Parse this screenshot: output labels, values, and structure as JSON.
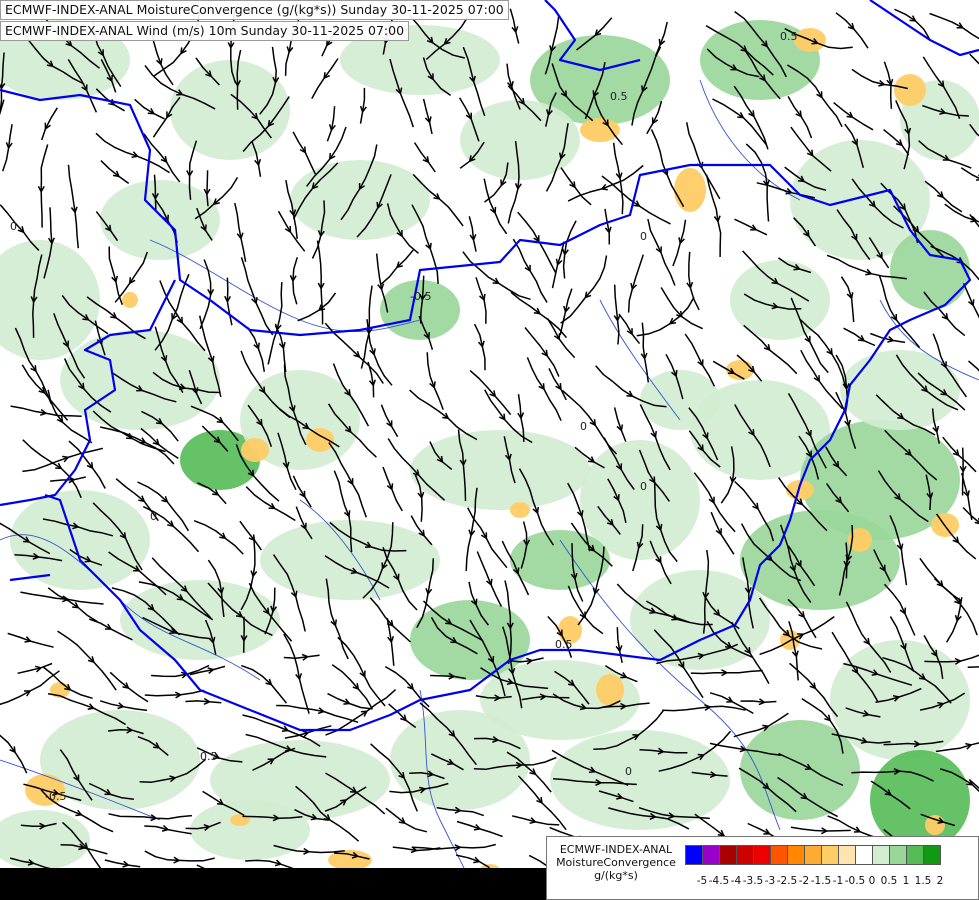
{
  "titles": {
    "line1": "ECMWF-INDEX-ANAL MoistureConvergence (g/(kg*s)) Sunday 30-11-2025 07:00",
    "line2": "ECMWF-INDEX-ANAL Wind (m/s) 10m Sunday 30-11-2025 07:00"
  },
  "legend": {
    "line1": "ECMWF-INDEX-ANAL",
    "line2": "MoistureConvergence",
    "line3": "g/(kg*s)",
    "ticks": [
      "-5",
      "-4.5",
      "-4",
      "-3.5",
      "-3",
      "-2.5",
      "-2",
      "-1.5",
      "-1",
      "-0.5",
      "0",
      "0.5",
      "1",
      "1.5",
      "2"
    ],
    "colors": [
      "#0000ff",
      "#9900cc",
      "#aa0000",
      "#cc0000",
      "#ee0000",
      "#ff5500",
      "#ff8800",
      "#ffaa33",
      "#ffcc66",
      "#ffe4b0",
      "#ffffff",
      "#d2ecd2",
      "#99d699",
      "#55bb55",
      "#119911"
    ]
  },
  "contour_labels": [
    "0",
    "0",
    "0",
    "0",
    "0",
    "0",
    "0.5",
    "0.5",
    "0.5",
    "0.5",
    "-0.5",
    "-0.5"
  ],
  "colors": {
    "border": "#0000ee",
    "rivers": "#3355cc",
    "streamlines": "#000000",
    "conv_light": "#d2ecd2",
    "conv_mid": "#99d699",
    "conv_strong": "#55bb55",
    "div_light": "#ffe4b0",
    "div_mid": "#ffcc66"
  }
}
